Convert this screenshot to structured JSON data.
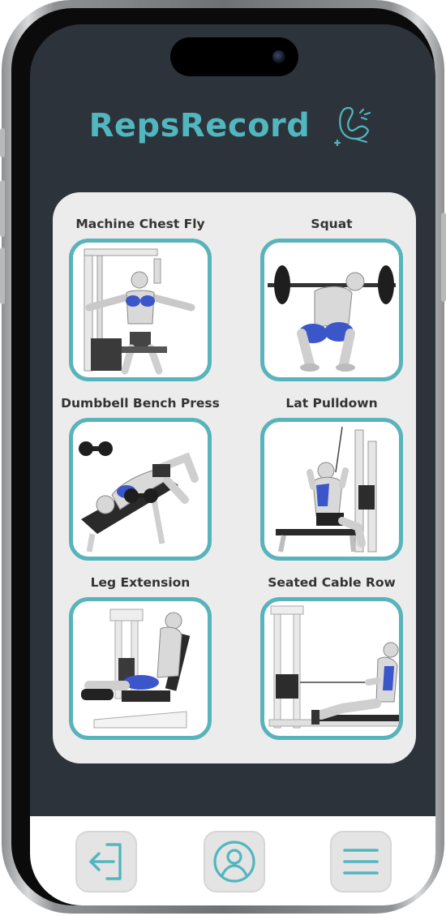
{
  "app": {
    "title": "RepsRecord",
    "accent_color": "#52b6be",
    "logo_icon": "flexed-arm-icon"
  },
  "exercises": [
    {
      "label": "Machine Chest Fly",
      "image": "machine-chest-fly-illustration"
    },
    {
      "label": "Squat",
      "image": "squat-illustration"
    },
    {
      "label": "Dumbbell Bench Press",
      "image": "dumbbell-bench-press-illustration"
    },
    {
      "label": "Lat Pulldown",
      "image": "lat-pulldown-illustration"
    },
    {
      "label": "Leg Extension",
      "image": "leg-extension-illustration"
    },
    {
      "label": "Seated Cable Row",
      "image": "seated-cable-row-illustration"
    }
  ],
  "nav": {
    "buttons": [
      {
        "icon": "logout-arrow-icon"
      },
      {
        "icon": "profile-icon"
      },
      {
        "icon": "menu-icon"
      }
    ]
  }
}
